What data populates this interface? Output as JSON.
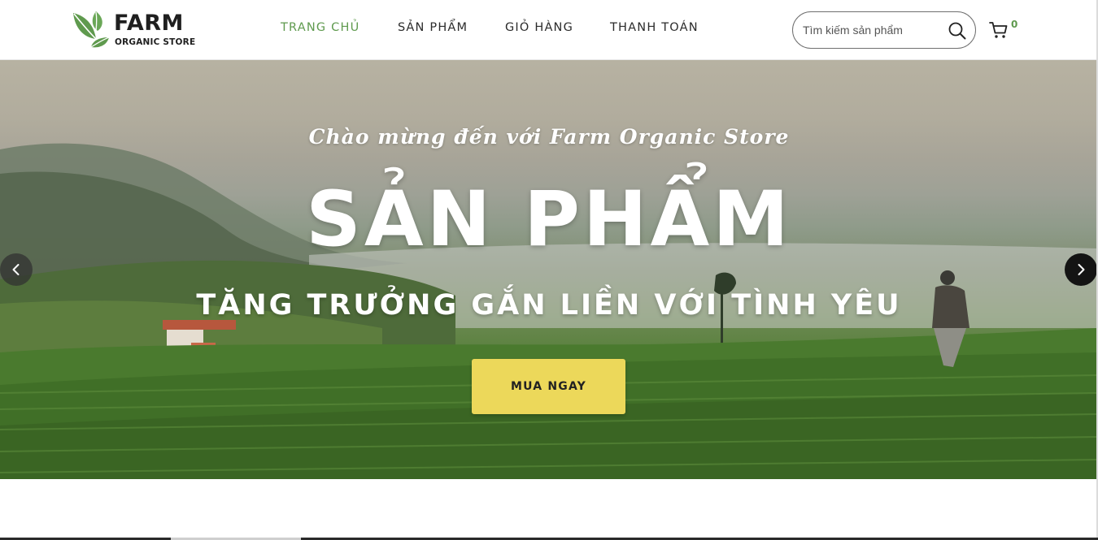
{
  "brand": {
    "name": "FARM",
    "tagline": "ORGANIC STORE",
    "color_green": "#5f9a4e",
    "color_dark": "#1f1f1f"
  },
  "nav": {
    "items": [
      {
        "label": "TRANG CHỦ",
        "active": true
      },
      {
        "label": "SẢN PHẨM",
        "active": false
      },
      {
        "label": "GIỎ HÀNG",
        "active": false
      },
      {
        "label": "THANH TOÁN",
        "active": false
      }
    ]
  },
  "search": {
    "placeholder": "Tìm kiếm sản phẩm",
    "value": "",
    "icon": "search-icon"
  },
  "cart": {
    "icon": "cart-icon",
    "count": "0"
  },
  "hero": {
    "subtitle": "Chào mừng đến với Farm Organic Store",
    "title": "SẢN PHẨM",
    "tagline": "TĂNG TRƯỞNG GẮN LIỀN VỚI TÌNH YÊU",
    "cta_label": "MUA NGAY",
    "cta_color": "#ecd85a",
    "prev_icon": "chevron-left-icon",
    "next_icon": "chevron-right-icon"
  }
}
